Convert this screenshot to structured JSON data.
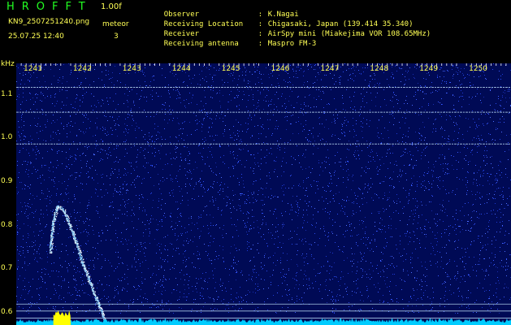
{
  "header": {
    "app_title": "HROFFT",
    "version": "1.00f",
    "filename": "KN9_2507251240.png",
    "mode_label": "meteor",
    "datetime": "25.07.25 12:40",
    "count": "3"
  },
  "info": [
    {
      "label": "Observer",
      "value": "K.Nagai"
    },
    {
      "label": "Receiving Location",
      "value": "Chigasaki, Japan (139.414 35.340)"
    },
    {
      "label": "Receiver",
      "value": "AirSpy mini (Miakejima VOR 108.65MHz)"
    },
    {
      "label": "Receiving antenna",
      "value": "Maspro FM-3"
    }
  ],
  "chart_data": {
    "type": "heatmap",
    "y_unit": "kHz",
    "x_ticks": [
      "1241",
      "1242",
      "1243",
      "1244",
      "1245",
      "1246",
      "1247",
      "1248",
      "1249",
      "1250"
    ],
    "y_ticks": [
      "1.1",
      "1.0",
      "0.9",
      "0.8",
      "0.7",
      "0.6"
    ],
    "xlim": [
      1240.5,
      1250.5
    ],
    "ylim": [
      0.57,
      1.17
    ],
    "horizontal_carriers_khz": [
      1.115,
      1.058,
      0.985,
      0.618,
      0.602,
      0.586
    ],
    "meteor_trail": [
      {
        "x": 1241.18,
        "y": 0.735
      },
      {
        "x": 1241.25,
        "y": 0.81
      },
      {
        "x": 1241.33,
        "y": 0.843
      },
      {
        "x": 1241.45,
        "y": 0.835
      },
      {
        "x": 1241.65,
        "y": 0.78
      },
      {
        "x": 1241.85,
        "y": 0.71
      },
      {
        "x": 1242.1,
        "y": 0.635
      },
      {
        "x": 1242.3,
        "y": 0.58
      }
    ],
    "bright_region_x": [
      1241.25,
      1241.6
    ],
    "colors": {
      "background": "#000a55",
      "noise": "#3a5cff",
      "carrier": "#c8e8ff",
      "signal": "#ffffff",
      "spectrum": "#00ccff",
      "peak": "#ffff00",
      "text": "#ffff55",
      "title": "#22ff22"
    }
  }
}
